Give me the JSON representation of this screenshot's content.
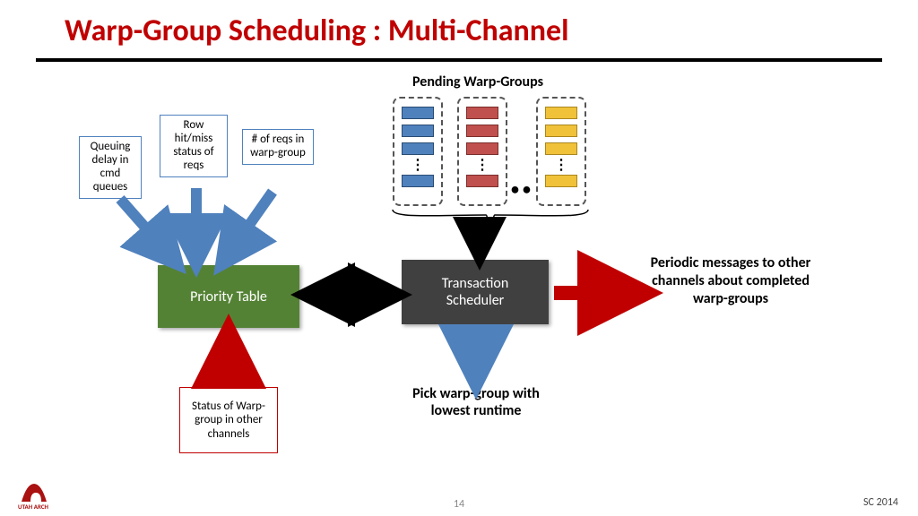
{
  "title": "Warp-Group Scheduling : Multi-Channel",
  "pending_label": "Pending Warp-Groups",
  "inputs": {
    "queuing": "Queuing delay in cmd queues",
    "rowhit": "Row hit/miss status of reqs",
    "nreqs": "# of reqs in warp-group"
  },
  "priority_label": "Priority Table",
  "txsched_label": "Transaction\nScheduler",
  "status_label": "Status of Warp-group in other channels",
  "periodic_msg": "Periodic messages to other channels about completed warp-groups",
  "pick_label": "Pick warp-group with lowest runtime",
  "page_number": "14",
  "conf": "SC 2014",
  "logo_text": "UTAH ARCH"
}
